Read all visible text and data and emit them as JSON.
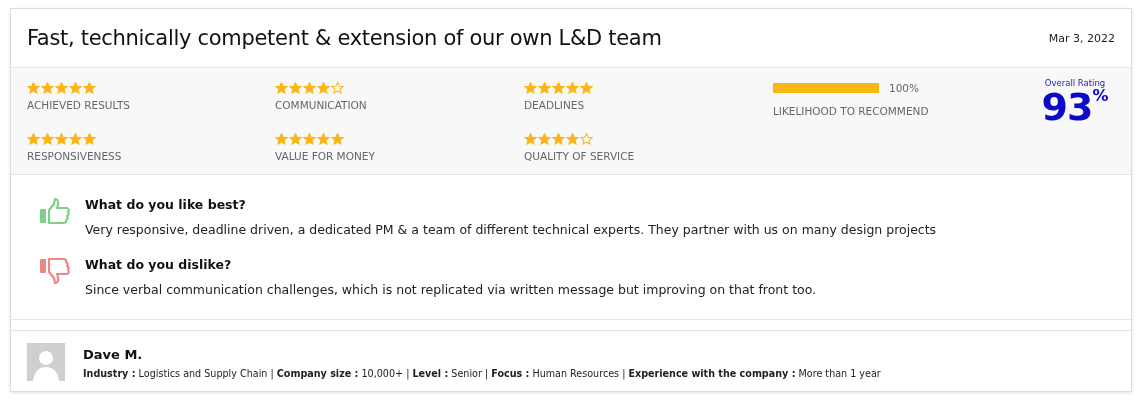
{
  "review": {
    "title": "Fast, technically competent & extension of our own L&D team",
    "date": "Mar 3, 2022"
  },
  "ratings": [
    {
      "label": "ACHIEVED RESULTS",
      "stars": 5
    },
    {
      "label": "COMMUNICATION",
      "stars": 4
    },
    {
      "label": "DEADLINES",
      "stars": 5
    },
    {
      "label": "RESPONSIVENESS",
      "stars": 5
    },
    {
      "label": "VALUE FOR MONEY",
      "stars": 5
    },
    {
      "label": "QUALITY OF SERVICE",
      "stars": 4
    }
  ],
  "recommend": {
    "label": "LIKELIHOOD TO RECOMMEND",
    "level": 1,
    "reading": "100%"
  },
  "overall": {
    "label": "Overall Rating",
    "value": "93",
    "unit": "%"
  },
  "feedback": [
    {
      "kind": "like",
      "question": "What do you like best?",
      "answer": "Very responsive, deadline driven, a dedicated PM & a team of different technical experts. They partner with us on many design projects"
    },
    {
      "kind": "dislike",
      "question": "What do you dislike?",
      "answer": "Since verbal communication challenges, which is not replicated via written message but improving on that front too."
    }
  ],
  "reviewer": {
    "name": "Dave M.",
    "details": "**Industry :** Logistics and Supply Chain | **Company size :** 10,000+ | **Level :** Senior | **Focus :** Human Resources | **Experience with the company :** More than 1 year"
  }
}
